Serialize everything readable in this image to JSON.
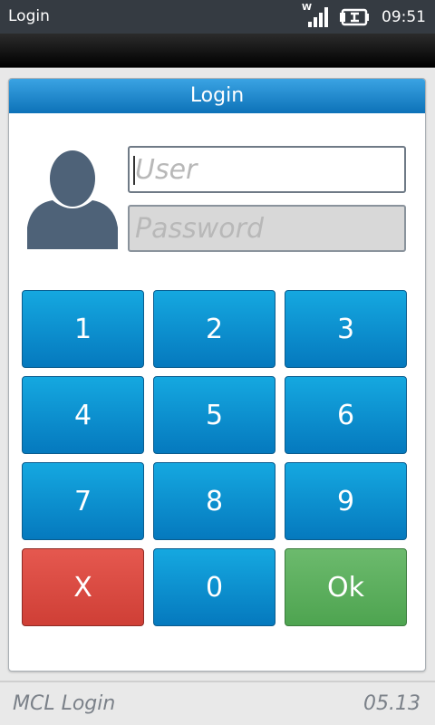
{
  "status_bar": {
    "title": "Login",
    "time": "09:51",
    "network_label": "W",
    "icons": [
      "signal-icon",
      "battery-charging-icon"
    ]
  },
  "dialog": {
    "title": "Login",
    "user_placeholder": "User",
    "password_placeholder": "Password",
    "avatar_icon": "user-avatar-icon"
  },
  "keypad": {
    "keys": [
      "1",
      "2",
      "3",
      "4",
      "5",
      "6",
      "7",
      "8",
      "9",
      "X",
      "0",
      "Ok"
    ]
  },
  "footer": {
    "app_name": "MCL Login",
    "version": "05.13"
  },
  "colors": {
    "key_blue": "#0a8fd0",
    "cancel_red": "#dc4a42",
    "ok_green": "#5cae5e",
    "header_blue": "#1e87cb"
  }
}
